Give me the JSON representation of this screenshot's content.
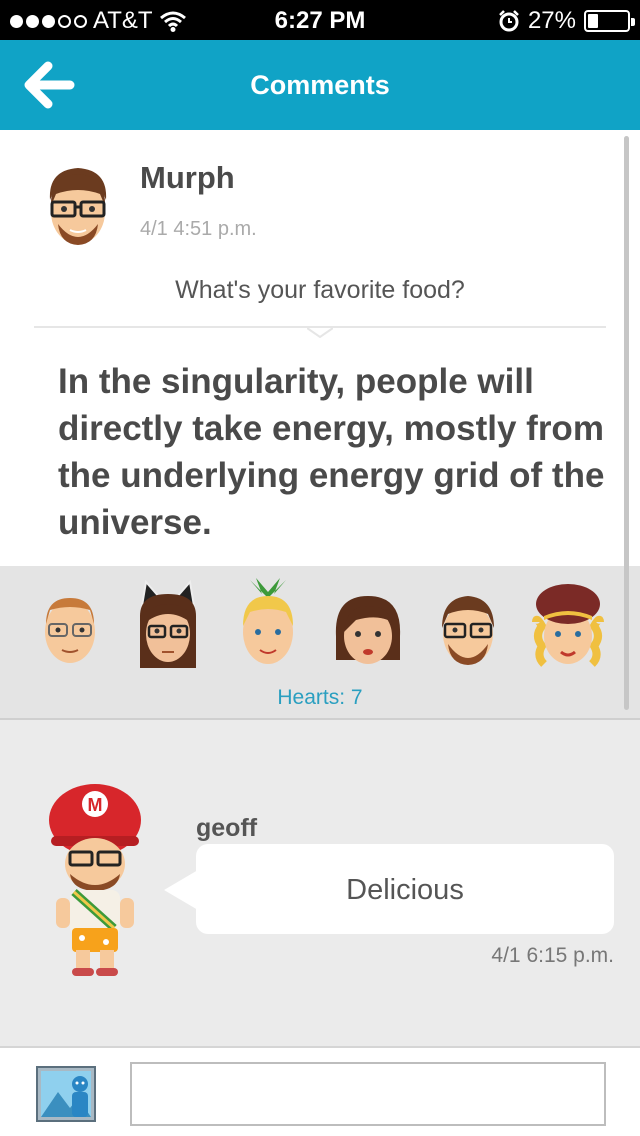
{
  "status_bar": {
    "carrier": "AT&T",
    "time": "6:27 PM",
    "battery": "27%",
    "battery_level": 0.27,
    "signal_bars_filled": 3,
    "signal_bars_total": 5
  },
  "header": {
    "title": "Comments",
    "back_icon": "back-arrow-icon",
    "color": "#10a3c6"
  },
  "post": {
    "author": "Murph",
    "date": "4/1 4:51 p.m.",
    "question": "What's your favorite food?",
    "answer": "In the singularity, people will directly take energy, mostly from the underlying energy grid of the universe."
  },
  "hearts": {
    "count_label": "Hearts: 7",
    "avatars": [
      "mii-face-bald-glasses",
      "mii-face-cat-ears",
      "mii-face-pineapple-hair",
      "mii-face-brown-bob",
      "mii-face-murph",
      "mii-face-curly-blonde"
    ]
  },
  "comments": [
    {
      "author": "geoff",
      "text": "Delicious",
      "date": "4/1 6:15 p.m."
    }
  ],
  "footer": {
    "photo_icon": "photo-icon",
    "input_value": "",
    "input_placeholder": ""
  }
}
